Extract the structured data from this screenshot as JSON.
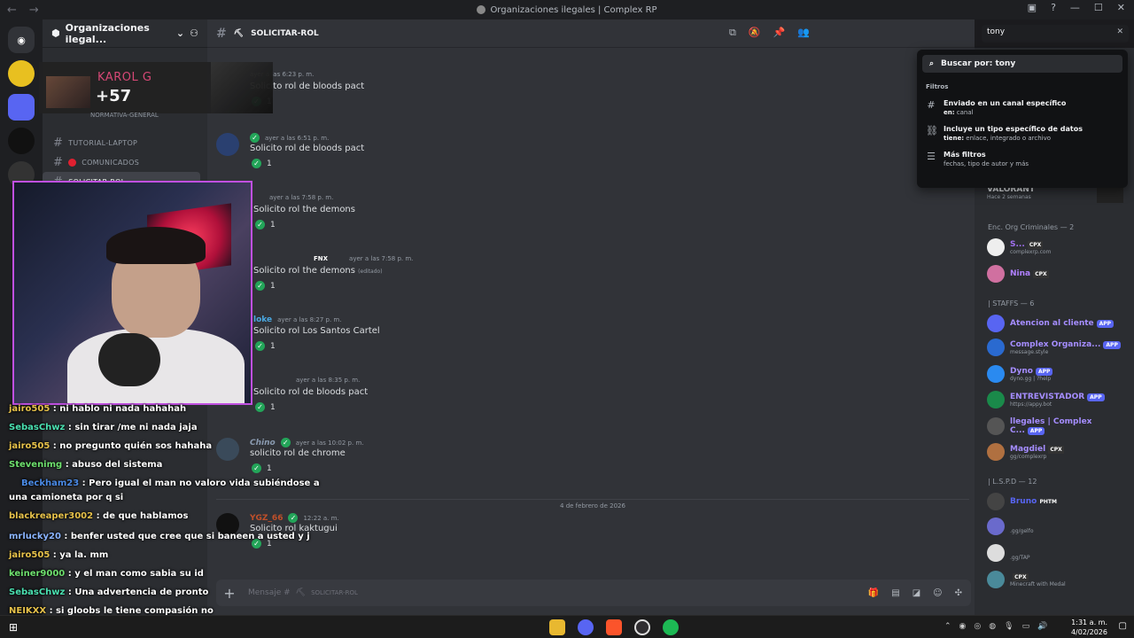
{
  "window": {
    "title": "Organizaciones ilegales | Complex RP"
  },
  "guild": {
    "name": "Organizaciones ilegal..."
  },
  "channels": [
    {
      "label": "normativa-general"
    },
    {
      "label": "tutorial-laptop"
    },
    {
      "label": "comunicados"
    },
    {
      "label": "solicitar-rol"
    }
  ],
  "header": {
    "channel": "solicitar-rol"
  },
  "search": {
    "value": "tony"
  },
  "popup": {
    "query_label": "Buscar por: tony",
    "filters_label": "Filtros",
    "f1_title": "Enviado en un canal específico",
    "f1_key": "en:",
    "f1_val": "canal",
    "f2_title": "Incluye un tipo específico de datos",
    "f2_key": "tiene:",
    "f2_val": "enlace, integrado o archivo",
    "f3_title": "Más filtros",
    "f3_sub": "fechas, tipo de autor y más"
  },
  "messages": [
    {
      "time": "ayer a las 6:23 p. m.",
      "text": "Solicito rol de bloods pact",
      "count": "1"
    },
    {
      "time": "ayer a las 6:51 p. m.",
      "text": "Solicito rol de bloods pact",
      "count": "1"
    },
    {
      "time": "ayer a las 7:58 p. m.",
      "text": "Solicito rol the demons",
      "count": "1"
    },
    {
      "time": "ayer a las 7:58 p. m.",
      "badge": "FNX",
      "text": "Solicito rol the demons",
      "edited": "(editado)",
      "count": "1"
    },
    {
      "author": "loke",
      "time": "ayer a las 8:27 p. m.",
      "text": "Solicito rol Los Santos Cartel",
      "count": "1"
    },
    {
      "time": "ayer a las 8:35 p. m.",
      "text": "Solicito rol de bloods pact",
      "count": "1"
    },
    {
      "author": "Chino",
      "time": "ayer a las 10:02 p. m.",
      "text": "solicito rol de chrome",
      "count": "1"
    },
    {
      "author": "YGZ_66",
      "time": "12:22 a. m.",
      "text": "Solicito rol  kaktugui",
      "count": "1"
    }
  ],
  "date_divider": "4 de febrero de 2026",
  "composer": {
    "placeholder": "Mensaje #",
    "channel": "solicitar-rol"
  },
  "members": {
    "activity_name": "VALORANT",
    "activity_sub": "Hace 2 semanas",
    "group1": "Enc. Org Criminales — 2",
    "g1_m1_sub": "complexrp.com",
    "g1_m2": "Nina",
    "group2": "| STAFFS — 6",
    "s1": "Atencion al cliente",
    "s2": "Complex Organiza...",
    "s2_sub": "message.style",
    "s3": "Dyno",
    "s3_sub": "dyno.gg | ?help",
    "s4": "ENTREVISTADOR",
    "s4_sub": "https://appy.bot",
    "s5": "llegales | Complex C...",
    "s6": "Magdiel",
    "s6_sub": "gg/complexrp",
    "group3": "| L.S.P.D — 12",
    "l1_tag": "PHTM",
    "l2_sub": ".gg/gelfo",
    "l3_sub": ".gg/TAP",
    "l4_sub": "Minecraft with Medal",
    "app_tag": "APP",
    "cpx_tag": "CPX"
  },
  "stream_overlay": {
    "artist": "KAROL G",
    "count": "+57",
    "channel_label": "NORMATIVA-GENERAL"
  },
  "stream_chat": [
    {
      "user": "jairo505",
      "text": ": ni hablo ni nada hahahah",
      "color": "#e6c14a"
    },
    {
      "user": "SebasChwz",
      "text": ": sin tirar /me ni nada jaja",
      "color": "#4ae0b0"
    },
    {
      "user": "jairo505",
      "text": ": no pregunto quién sos hahaha",
      "color": "#e6c14a"
    },
    {
      "user": "Stevenimg",
      "text": ": abuso del sistema",
      "color": "#6ee06e"
    },
    {
      "user": "Beckham23",
      "text": ": Pero igual el man no valoro vida subiéndose a",
      "color": "#4a8ae6"
    },
    {
      "user": "",
      "text": "una camioneta por q si",
      "color": "#ffffff"
    },
    {
      "user": "blackreaper3002",
      "text": ": de que hablamos",
      "color": "#e6c14a"
    },
    {
      "user": "mrlucky20",
      "text": ": benfer usted que cree que si baneen a usted y j",
      "color": "#8ab4ff"
    },
    {
      "user": "jairo505",
      "text": ": ya la. mm",
      "color": "#e6c14a"
    },
    {
      "user": "keiner9000",
      "text": ": y el man como sabia su id",
      "color": "#6ee06e"
    },
    {
      "user": "SebasChwz",
      "text": ": Una advertencia de pronto",
      "color": "#4ae0b0"
    },
    {
      "user": "NEIKXX",
      "text": ": si gloobs le tiene compasión no",
      "color": "#e6c14a"
    }
  ],
  "tray": {
    "time": "1:31 a. m.",
    "date": "4/02/2026"
  },
  "colors": {
    "accent": "#5865f2",
    "check": "#23a559",
    "webcam_border": "#c050e0"
  }
}
